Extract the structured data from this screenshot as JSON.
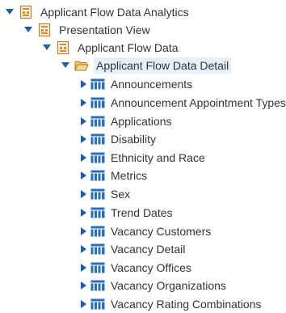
{
  "tree": {
    "root": {
      "label": "Applicant Flow Data Analytics",
      "expanded": true
    },
    "presentation": {
      "label": "Presentation View",
      "expanded": true
    },
    "subject_area": {
      "label": "Applicant Flow Data",
      "expanded": true
    },
    "folder": {
      "label": "Applicant Flow Data Detail",
      "expanded": true,
      "selected": true
    },
    "tables": [
      {
        "label": "Announcements"
      },
      {
        "label": "Announcement Appointment Types"
      },
      {
        "label": "Applications"
      },
      {
        "label": "Disability"
      },
      {
        "label": "Ethnicity and Race"
      },
      {
        "label": "Metrics"
      },
      {
        "label": "Sex"
      },
      {
        "label": "Trend Dates"
      },
      {
        "label": "Vacancy Customers"
      },
      {
        "label": "Vacancy Detail"
      },
      {
        "label": "Vacancy Offices"
      },
      {
        "label": "Vacancy Organizations"
      },
      {
        "label": "Vacancy Rating Combinations"
      }
    ]
  },
  "colors": {
    "toggle_blue": "#1e5ea8",
    "table_icon_blue": "#2a6fbf",
    "folder_orange": "#e8a033",
    "selection_bg": "#e4f1fb",
    "text": "#333333"
  },
  "icons": {
    "expanded_toggle": "triangle-down-icon",
    "collapsed_toggle": "triangle-right-icon",
    "catalog": "catalog-icon",
    "folder": "folder-open-icon",
    "table": "table-icon"
  }
}
